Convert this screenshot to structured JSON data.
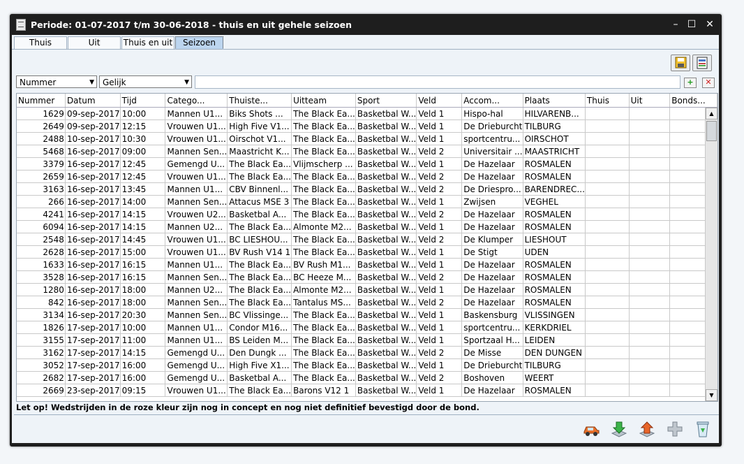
{
  "window": {
    "title": "Periode: 01-07-2017 t/m 30-06-2018 - thuis en uit gehele seizoen"
  },
  "tabs": [
    {
      "label": "Thuis"
    },
    {
      "label": "Uit"
    },
    {
      "label": "Thuis en uit"
    },
    {
      "label": "Seizoen"
    }
  ],
  "filter": {
    "field": "Nummer",
    "operator": "Gelijk",
    "value": ""
  },
  "table": {
    "columns": [
      "Nummer",
      "Datum",
      "Tijd",
      "Catego...",
      "Thuiste...",
      "Uitteam",
      "Sport",
      "Veld",
      "Accom...",
      "Plaats",
      "Thuis",
      "Uit",
      "Bonds..."
    ],
    "rows": [
      [
        "1629",
        "09-sep-2017",
        "10:00",
        "Mannen U1...",
        "Biks Shots ...",
        "The Black Ea...",
        "Basketbal W...",
        "Veld 1",
        "Hispo-hal",
        "HILVARENB...",
        "",
        "",
        ""
      ],
      [
        "2649",
        "09-sep-2017",
        "12:15",
        "Vrouwen U1...",
        "High Five V1...",
        "The Black Ea...",
        "Basketbal W...",
        "Veld 1",
        "De Drieburcht",
        "TILBURG",
        "",
        "",
        ""
      ],
      [
        "2488",
        "10-sep-2017",
        "10:30",
        "Vrouwen U1...",
        "Oirschot V1...",
        "The Black Ea...",
        "Basketbal W...",
        "Veld 1",
        "sportcentru...",
        "OIRSCHOT",
        "",
        "",
        ""
      ],
      [
        "5468",
        "16-sep-2017",
        "09:00",
        "Mannen Sen...",
        "Maastricht K...",
        "The Black Ea...",
        "Basketbal W...",
        "Veld 2",
        "Universitair ...",
        "MAASTRICHT",
        "",
        "",
        ""
      ],
      [
        "3379",
        "16-sep-2017",
        "12:45",
        "Gemengd U...",
        "The Black Ea...",
        "Vlijmscherp ...",
        "Basketbal W...",
        "Veld 1",
        "De Hazelaar",
        "ROSMALEN",
        "",
        "",
        ""
      ],
      [
        "2659",
        "16-sep-2017",
        "12:45",
        "Vrouwen U1...",
        "The Black Ea...",
        "The Black Ea...",
        "Basketbal W...",
        "Veld 2",
        "De Hazelaar",
        "ROSMALEN",
        "",
        "",
        ""
      ],
      [
        "3163",
        "16-sep-2017",
        "13:45",
        "Mannen U1...",
        "CBV Binnenl...",
        "The Black Ea...",
        "Basketbal W...",
        "Veld 2",
        "De Driespro...",
        "BARENDREC...",
        "",
        "",
        ""
      ],
      [
        "266",
        "16-sep-2017",
        "14:00",
        "Mannen Sen...",
        "Attacus MSE 3",
        "The Black Ea...",
        "Basketbal W...",
        "Veld 1",
        "Zwijsen",
        "VEGHEL",
        "",
        "",
        ""
      ],
      [
        "4241",
        "16-sep-2017",
        "14:15",
        "Vrouwen U2...",
        "Basketbal A...",
        "The Black Ea...",
        "Basketbal W...",
        "Veld 2",
        "De Hazelaar",
        "ROSMALEN",
        "",
        "",
        ""
      ],
      [
        "6094",
        "16-sep-2017",
        "14:15",
        "Mannen U2...",
        "The Black Ea...",
        "Almonte M2...",
        "Basketbal W...",
        "Veld 1",
        "De Hazelaar",
        "ROSMALEN",
        "",
        "",
        ""
      ],
      [
        "2548",
        "16-sep-2017",
        "14:45",
        "Vrouwen U1...",
        "BC LIESHOU...",
        "The Black Ea...",
        "Basketbal W...",
        "Veld 2",
        "De Klumper",
        "LIESHOUT",
        "",
        "",
        ""
      ],
      [
        "2628",
        "16-sep-2017",
        "15:00",
        "Vrouwen U1...",
        "BV Rush V14 1",
        "The Black Ea...",
        "Basketbal W...",
        "Veld 1",
        "De Stigt",
        "UDEN",
        "",
        "",
        ""
      ],
      [
        "1633",
        "16-sep-2017",
        "16:15",
        "Mannen U1...",
        "The Black Ea...",
        "BV Rush M1...",
        "Basketbal W...",
        "Veld 1",
        "De Hazelaar",
        "ROSMALEN",
        "",
        "",
        ""
      ],
      [
        "3528",
        "16-sep-2017",
        "16:15",
        "Mannen Sen...",
        "The Black Ea...",
        "BC Heeze M...",
        "Basketbal W...",
        "Veld 2",
        "De Hazelaar",
        "ROSMALEN",
        "",
        "",
        ""
      ],
      [
        "1280",
        "16-sep-2017",
        "18:00",
        "Mannen U2...",
        "The Black Ea...",
        "Almonte M2...",
        "Basketbal W...",
        "Veld 1",
        "De Hazelaar",
        "ROSMALEN",
        "",
        "",
        ""
      ],
      [
        "842",
        "16-sep-2017",
        "18:00",
        "Mannen Sen...",
        "The Black Ea...",
        "Tantalus MS...",
        "Basketbal W...",
        "Veld 2",
        "De Hazelaar",
        "ROSMALEN",
        "",
        "",
        ""
      ],
      [
        "3134",
        "16-sep-2017",
        "20:30",
        "Mannen Sen...",
        "BC Vlissinge...",
        "The Black Ea...",
        "Basketbal W...",
        "Veld 1",
        "Baskensburg",
        "VLISSINGEN",
        "",
        "",
        ""
      ],
      [
        "1826",
        "17-sep-2017",
        "10:00",
        "Mannen U1...",
        "Condor M16...",
        "The Black Ea...",
        "Basketbal W...",
        "Veld 1",
        "sportcentru...",
        "KERKDRIEL",
        "",
        "",
        ""
      ],
      [
        "3155",
        "17-sep-2017",
        "11:00",
        "Mannen U1...",
        "BS Leiden M...",
        "The Black Ea...",
        "Basketbal W...",
        "Veld 1",
        "Sportzaal H...",
        "LEIDEN",
        "",
        "",
        ""
      ],
      [
        "3162",
        "17-sep-2017",
        "14:15",
        "Gemengd U...",
        "Den Dungk ...",
        "The Black Ea...",
        "Basketbal W...",
        "Veld 2",
        "De Misse",
        "DEN DUNGEN",
        "",
        "",
        ""
      ],
      [
        "3052",
        "17-sep-2017",
        "16:00",
        "Gemengd U...",
        "High Five X1...",
        "The Black Ea...",
        "Basketbal W...",
        "Veld 1",
        "De Drieburcht",
        "TILBURG",
        "",
        "",
        ""
      ],
      [
        "2682",
        "17-sep-2017",
        "16:00",
        "Gemengd U...",
        "Basketbal A...",
        "The Black Ea...",
        "Basketbal W...",
        "Veld 2",
        "Boshoven",
        "WEERT",
        "",
        "",
        ""
      ],
      [
        "2669",
        "23-sep-2017",
        "09:15",
        "Vrouwen U1...",
        "The Black Ea...",
        "Barons V12 1",
        "Basketbal W...",
        "Veld 1",
        "De Hazelaar",
        "ROSMALEN",
        "",
        "",
        ""
      ]
    ]
  },
  "note": "Let op! Wedstrijden in de roze kleur zijn nog in concept en nog niet definitief bevestigd door de bond.",
  "icons": {
    "save": "save-icon",
    "export": "export-icon",
    "car": "car-icon",
    "download": "download-icon",
    "upload": "upload-icon",
    "add": "add-icon",
    "delete": "trash-icon"
  }
}
